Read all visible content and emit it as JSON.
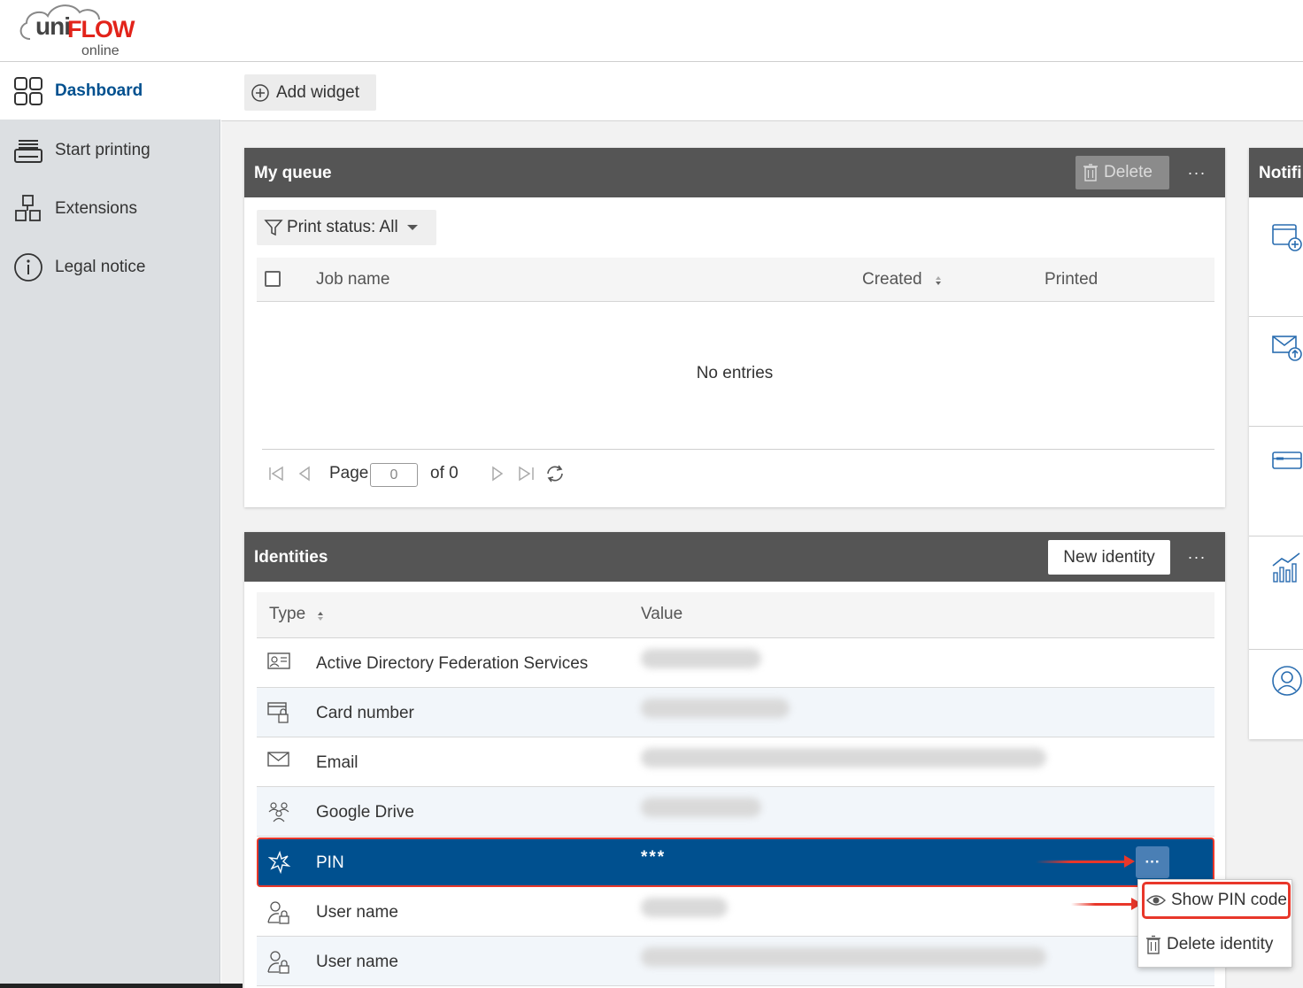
{
  "app": {
    "logo_uni": "uni",
    "logo_flow": "FLOW",
    "logo_online": "online",
    "brand_color": "#e2231a",
    "accent_color": "#00508f"
  },
  "sidebar": {
    "items": [
      {
        "label": "Dashboard",
        "icon": "dashboard-grid-icon",
        "active": true
      },
      {
        "label": "Start printing",
        "icon": "printer-icon",
        "active": false
      },
      {
        "label": "Extensions",
        "icon": "cubes-icon",
        "active": false
      },
      {
        "label": "Legal notice",
        "icon": "info-circle-icon",
        "active": false
      }
    ]
  },
  "toolbar": {
    "add_widget_label": "Add widget"
  },
  "queue": {
    "title": "My queue",
    "delete_label": "Delete",
    "more_label": "···",
    "filter_label": "Print status: All",
    "columns": {
      "job_name": "Job name",
      "created": "Created",
      "printed": "Printed"
    },
    "empty_text": "No entries",
    "pager": {
      "page_label": "Page",
      "page_value": "0",
      "of_label": "of 0"
    }
  },
  "identities": {
    "title": "Identities",
    "new_label": "New identity",
    "more_label": "···",
    "columns": {
      "type": "Type",
      "value": "Value"
    },
    "rows": [
      {
        "type": "Active Directory Federation Services",
        "icon": "id-card-icon",
        "value_hidden": true
      },
      {
        "type": "Card number",
        "icon": "card-lock-icon",
        "value_hidden": true
      },
      {
        "type": "Email",
        "icon": "envelope-icon",
        "value_hidden": true
      },
      {
        "type": "Google Drive",
        "icon": "users-icon",
        "value_hidden": true
      },
      {
        "type": "PIN",
        "icon": "asterisk-icon",
        "value": "***",
        "selected": true
      },
      {
        "type": "User name",
        "icon": "user-lock-icon",
        "value_hidden": true
      },
      {
        "type": "User name",
        "icon": "user-lock-icon",
        "value_hidden": true
      }
    ],
    "row_more_label": "···"
  },
  "context_menu": {
    "items": [
      {
        "label": "Show PIN code",
        "icon": "eye-icon"
      },
      {
        "label": "Delete identity",
        "icon": "trash-icon"
      }
    ]
  },
  "notifications": {
    "title": "Notifi"
  }
}
